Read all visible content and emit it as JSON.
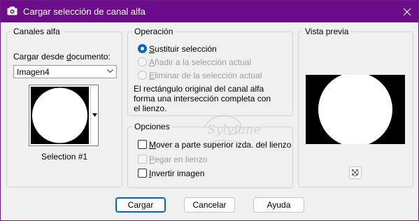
{
  "window": {
    "title": "Cargar selección de canal alfa",
    "title_icon": "camera-icon",
    "close_icon": "close-icon"
  },
  "canales": {
    "title": "Canales alfa",
    "doc_label_pre": "Cargar desde ",
    "doc_label_u": "d",
    "doc_label_post": "ocumento:",
    "doc_value": "Imagen4",
    "selection_name": "Selection #1"
  },
  "operacion": {
    "title": "Operación",
    "options": [
      {
        "u": "S",
        "rest": "ustituir selección",
        "checked": true,
        "enabled": true
      },
      {
        "u": "A",
        "rest": "ñadir a la selección actual",
        "checked": false,
        "enabled": false
      },
      {
        "u": "E",
        "rest": "liminar de la selección actual",
        "checked": false,
        "enabled": false
      }
    ],
    "description_line1": "El rectángulo original del canal alfa",
    "description_line2": "forma una intersección completa con",
    "description_line3": "el lienzo."
  },
  "opciones": {
    "title": "Opciones",
    "items": [
      {
        "u": "M",
        "rest": "over a parte superior izda. del lienzo",
        "checked": false,
        "enabled": true
      },
      {
        "u": "P",
        "rest": "egar en lienzo",
        "checked": false,
        "enabled": false
      },
      {
        "u": "I",
        "rest": "nvertir imagen",
        "checked": false,
        "enabled": true
      }
    ]
  },
  "preview": {
    "title": "Vista previa",
    "toggle_icon": "checkerboard-icon"
  },
  "buttons": {
    "load": "Cargar",
    "cancel": "Cancelar",
    "help": "Ayuda"
  },
  "watermark": {
    "text": "Sylviane"
  }
}
